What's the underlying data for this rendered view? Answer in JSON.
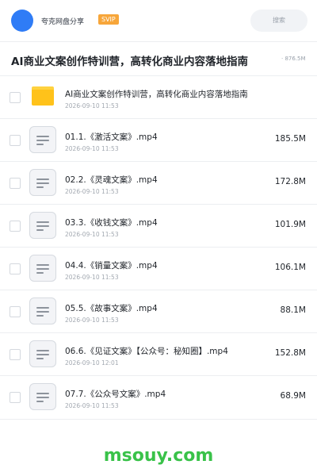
{
  "header": {
    "owner": "夸克网盘分享",
    "badge": "SVIP",
    "search_placeholder": "搜索"
  },
  "folder": {
    "title": "AI商业文案创作特训营，高转化商业内容落地指南",
    "total_size": "· 876.5M"
  },
  "files": [
    {
      "name": "AI商业文案创作特训营，高转化商业内容落地指南",
      "date": "2026-09-10 11:53",
      "size": "",
      "icon": "folder-icon"
    },
    {
      "name": "01.1.《激活文案》.mp4",
      "date": "2026-09-10 11:53",
      "size": "185.5M",
      "icon": "document-icon"
    },
    {
      "name": "02.2.《灵魂文案》.mp4",
      "date": "2026-09-10 11:53",
      "size": "172.8M",
      "icon": "document-icon"
    },
    {
      "name": "03.3.《收钱文案》.mp4",
      "date": "2026-09-10 11:53",
      "size": "101.9M",
      "icon": "document-icon"
    },
    {
      "name": "04.4.《销量文案》.mp4",
      "date": "2026-09-10 11:53",
      "size": "106.1M",
      "icon": "document-icon"
    },
    {
      "name": "05.5.《故事文案》.mp4",
      "date": "2026-09-10 11:53",
      "size": "88.1M",
      "icon": "document-icon"
    },
    {
      "name": "06.6.《见证文案》【公众号：秘知圈】.mp4",
      "date": "2026-09-10 12:01",
      "size": "152.8M",
      "icon": "document-icon"
    },
    {
      "name": "07.7.《公众号文案》.mp4",
      "date": "2026-09-10 11:53",
      "size": "68.9M",
      "icon": "document-icon"
    }
  ],
  "watermark": "msouy.com",
  "colors": {
    "accent": "#2f7cf6",
    "badge": "#f7a63a",
    "folder": "#ffc21a",
    "watermark": "#39c249"
  }
}
